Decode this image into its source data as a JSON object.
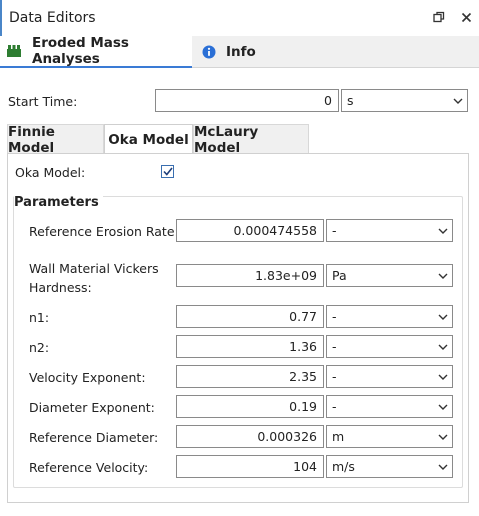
{
  "window": {
    "title": "Data Editors"
  },
  "top_tabs": [
    {
      "label": "Eroded Mass Analyses",
      "icon": "eroded-mass-icon",
      "active": true
    },
    {
      "label": "Info",
      "icon": "info-icon",
      "active": false
    }
  ],
  "start_time": {
    "label": "Start Time:",
    "value": "0",
    "unit": "s"
  },
  "model_tabs": [
    {
      "label": "Finnie Model",
      "active": false
    },
    {
      "label": "Oka Model",
      "active": true
    },
    {
      "label": "McLaury Model",
      "active": false
    }
  ],
  "oka": {
    "enable_label": "Oka Model:",
    "enabled": true,
    "group_title": "Parameters",
    "params": [
      {
        "label": "Reference Erosion Rate:",
        "value": "0.000474558",
        "unit": "-"
      },
      {
        "label": "Wall Material Vickers",
        "label2": "Hardness:",
        "value": "1.83e+09",
        "unit": "Pa"
      },
      {
        "label": "n1:",
        "value": "0.77",
        "unit": "-"
      },
      {
        "label": "n2:",
        "value": "1.36",
        "unit": "-"
      },
      {
        "label": "Velocity Exponent:",
        "value": "2.35",
        "unit": "-"
      },
      {
        "label": "Diameter Exponent:",
        "value": "0.19",
        "unit": "-"
      },
      {
        "label": "Reference Diameter:",
        "value": "0.000326",
        "unit": "m"
      },
      {
        "label": "Reference Velocity:",
        "value": "104",
        "unit": "m/s"
      }
    ]
  },
  "colors": {
    "accent": "#3a7bd5",
    "tab_bg": "#f0f0f0",
    "border": "#8a8a8a",
    "icon_green": "#2e7d32",
    "icon_blue": "#2a6fd6"
  }
}
